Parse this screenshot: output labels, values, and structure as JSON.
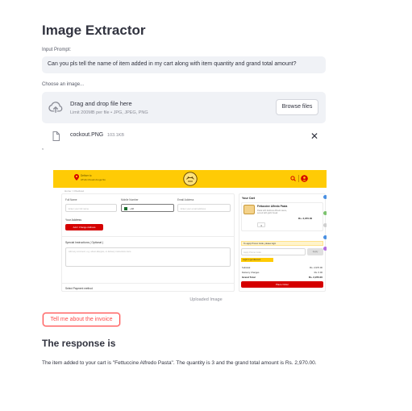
{
  "app": {
    "title": "Image Extractor"
  },
  "prompt": {
    "label": "Input Prompt:",
    "value": "Can you pls tell the name of item added in my cart along with item quantity and grand total amount?"
  },
  "uploader": {
    "label": "Choose an image...",
    "drag_text": "Drag and drop file here",
    "limit_text": "Limit 200MB per file • JPG, JPEG, PNG",
    "browse_label": "Browse files"
  },
  "file": {
    "name": "cockout.PNG",
    "size": "103.1KB"
  },
  "stray_char": ",",
  "uploaded_image": {
    "caption": "Uploaded Image",
    "location_line1": "Deliver to",
    "location_line2": "ATHA Chowk Aroga Nu",
    "crumb": "Home > Checkout",
    "full_name_label": "Full Name",
    "full_name_placeholder": "Enter your full name",
    "mobile_label": "Mobile Number",
    "mobile_prefix": "+92",
    "email_label": "Email Address",
    "email_placeholder": "Enter your email address",
    "address_label": "Your Address",
    "add_address_button": "Add / Change Address",
    "instructions_label": "Special Instructions ( Optional )",
    "instructions_placeholder": "Add any comment, e.g. about allergies, or delivery instructions here",
    "payment_label": "Select Payment method",
    "cart_title": "Your Cart",
    "item_name": "Fettuccine Alfredo Pasta",
    "item_desc": "Pasta with delicious Alfredo sauce, served with garlic bread",
    "item_price": "Rs. 2,970.00",
    "item_qty": "3",
    "promo_text": "To apply Promo Code, please login",
    "promo_placeholder": "Apply Promo Code",
    "promo_button": "Apply",
    "promo_note": "Login to get discount",
    "subtotal_label": "Subtotal",
    "subtotal_value": "Rs. 2,970.00",
    "delivery_label": "Delivery Charges",
    "delivery_value": "Rs. 0.00",
    "grand_total_label": "Grand Total",
    "grand_total_value": "Rs. 2,970.00",
    "place_order_button": "Place Order"
  },
  "action": {
    "invoice_button": "Tell me about the invoice"
  },
  "response": {
    "title": "The response is",
    "text": "The item added to your cart is \"Fettuccine Alfredo Pasta\". The quantity is 3 and the grand total amount is Rs. 2,970.00."
  },
  "colors": {
    "accent": "#ff4b4b",
    "brand_yellow": "#ffcb05",
    "brand_red": "#d50000",
    "muted_bg": "#f0f2f6"
  }
}
